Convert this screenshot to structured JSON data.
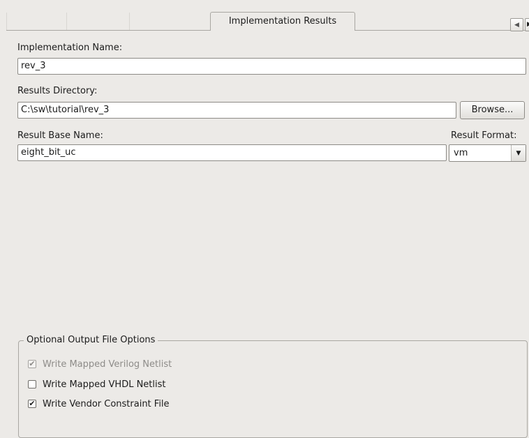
{
  "tabs": {
    "active_label": "Implementation Results",
    "scroll_prev": "◀",
    "scroll_next": "▶"
  },
  "implementation_name": {
    "label": "Implementation Name:",
    "value": "rev_3"
  },
  "results_directory": {
    "label": "Results Directory:",
    "value": "C:\\sw\\tutorial\\rev_3",
    "browse_label": "Browse..."
  },
  "result_base_name": {
    "label": "Result Base Name:",
    "value": "eight_bit_uc"
  },
  "result_format": {
    "label": "Result Format:",
    "value": "vm",
    "arrow": "▼"
  },
  "optional_output": {
    "title": "Optional Output File Options",
    "options": [
      {
        "label": "Write Mapped Verilog Netlist",
        "checked": true,
        "enabled": false,
        "mark": "✔"
      },
      {
        "label": "Write Mapped VHDL Netlist",
        "checked": false,
        "enabled": true,
        "mark": ""
      },
      {
        "label": "Write Vendor Constraint File",
        "checked": true,
        "enabled": true,
        "mark": "✔"
      }
    ]
  }
}
